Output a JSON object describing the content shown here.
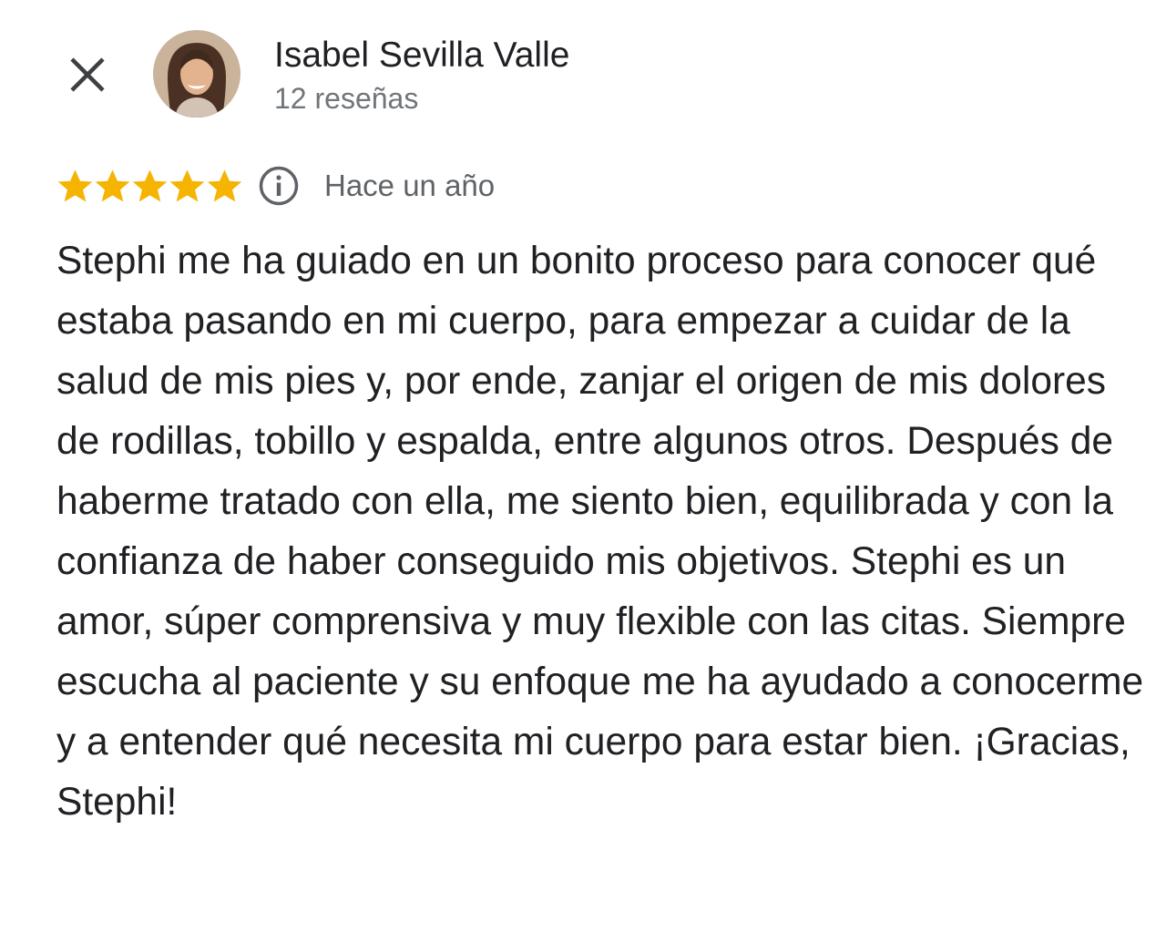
{
  "header": {
    "close_icon": "close-icon",
    "author_name": "Isabel Sevilla Valle",
    "review_count": "12 reseñas",
    "avatar_icon": "user-avatar"
  },
  "review": {
    "rating": 5,
    "max_rating": 5,
    "star_color": "#f4b400",
    "info_icon": "info-icon",
    "date": "Hace un año",
    "text": "Stephi me ha guiado en un bonito proceso para conocer qué estaba pasando en mi cuerpo, para empezar a cuidar de la salud de mis pies y, por ende, zanjar el origen de mis dolores de rodillas, tobillo y espalda, entre algunos otros. Después de haberme tratado con ella, me siento bien, equilibrada y con la confianza de haber conseguido mis objetivos. Stephi es un amor, súper comprensiva y muy flexible con las citas. Siempre escucha al paciente y su enfoque me ha ayudado a conocerme y a entender qué necesita mi cuerpo para estar bien. ¡Gracias, Stephi!"
  }
}
